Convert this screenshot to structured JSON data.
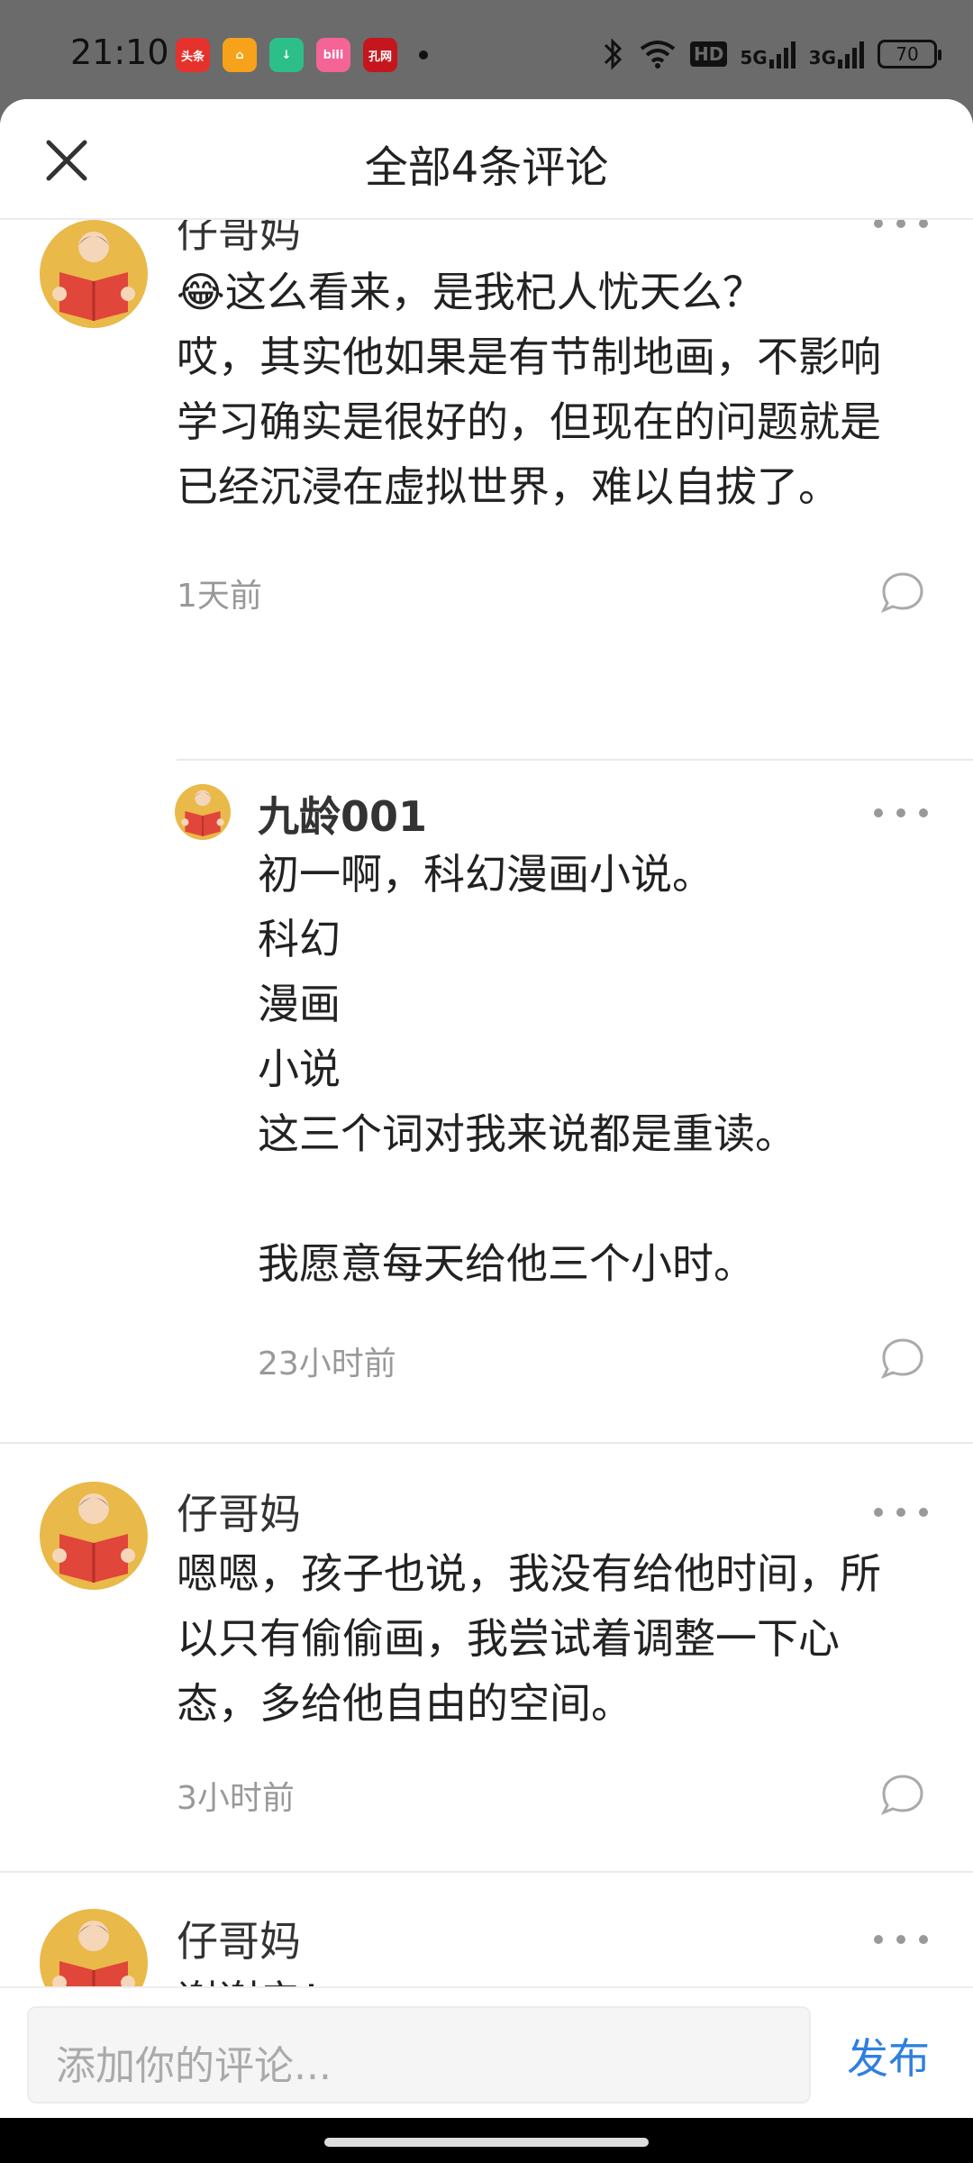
{
  "status_bar": {
    "time": "21:10",
    "apps": [
      {
        "label": "头条",
        "color": "#e5322d"
      },
      {
        "label": "⌂",
        "color": "#f6a21a"
      },
      {
        "label": "↓",
        "color": "#2dbf8a"
      },
      {
        "label": "bili",
        "color": "#f46496"
      },
      {
        "label": "孔网",
        "color": "#c5161d"
      }
    ],
    "signal_hd": "HD",
    "signal_5g": "5G",
    "signal_3g": "3G",
    "battery": "70"
  },
  "header": {
    "title": "全部4条评论"
  },
  "comments": [
    {
      "user": "仔哥妈",
      "text": "😂这么看来，是我杞人忧天么？\n哎，其实他如果是有节制地画，不影响\n学习确实是很好的，但现在的问题就是\n已经沉浸在虚拟世界，难以自拔了。",
      "time": "1天前"
    },
    {
      "user": "九龄001",
      "text": "初一啊，科幻漫画小说。\n科幻\n漫画\n小说\n这三个词对我来说都是重读。\n\n我愿意每天给他三个小时。",
      "time": "23小时前"
    },
    {
      "user": "仔哥妈",
      "text": "嗯嗯，孩子也说，我没有给他时间，所\n以只有偷偷画，我尝试着调整一下心\n态，多给他自由的空间。",
      "time": "3小时前"
    },
    {
      "user": "仔哥妈",
      "text": "谢谢亲！",
      "time": ""
    }
  ],
  "input": {
    "placeholder": "添加你的评论...",
    "publish_label": "发布",
    "publish_color": "#2f7fe0"
  }
}
